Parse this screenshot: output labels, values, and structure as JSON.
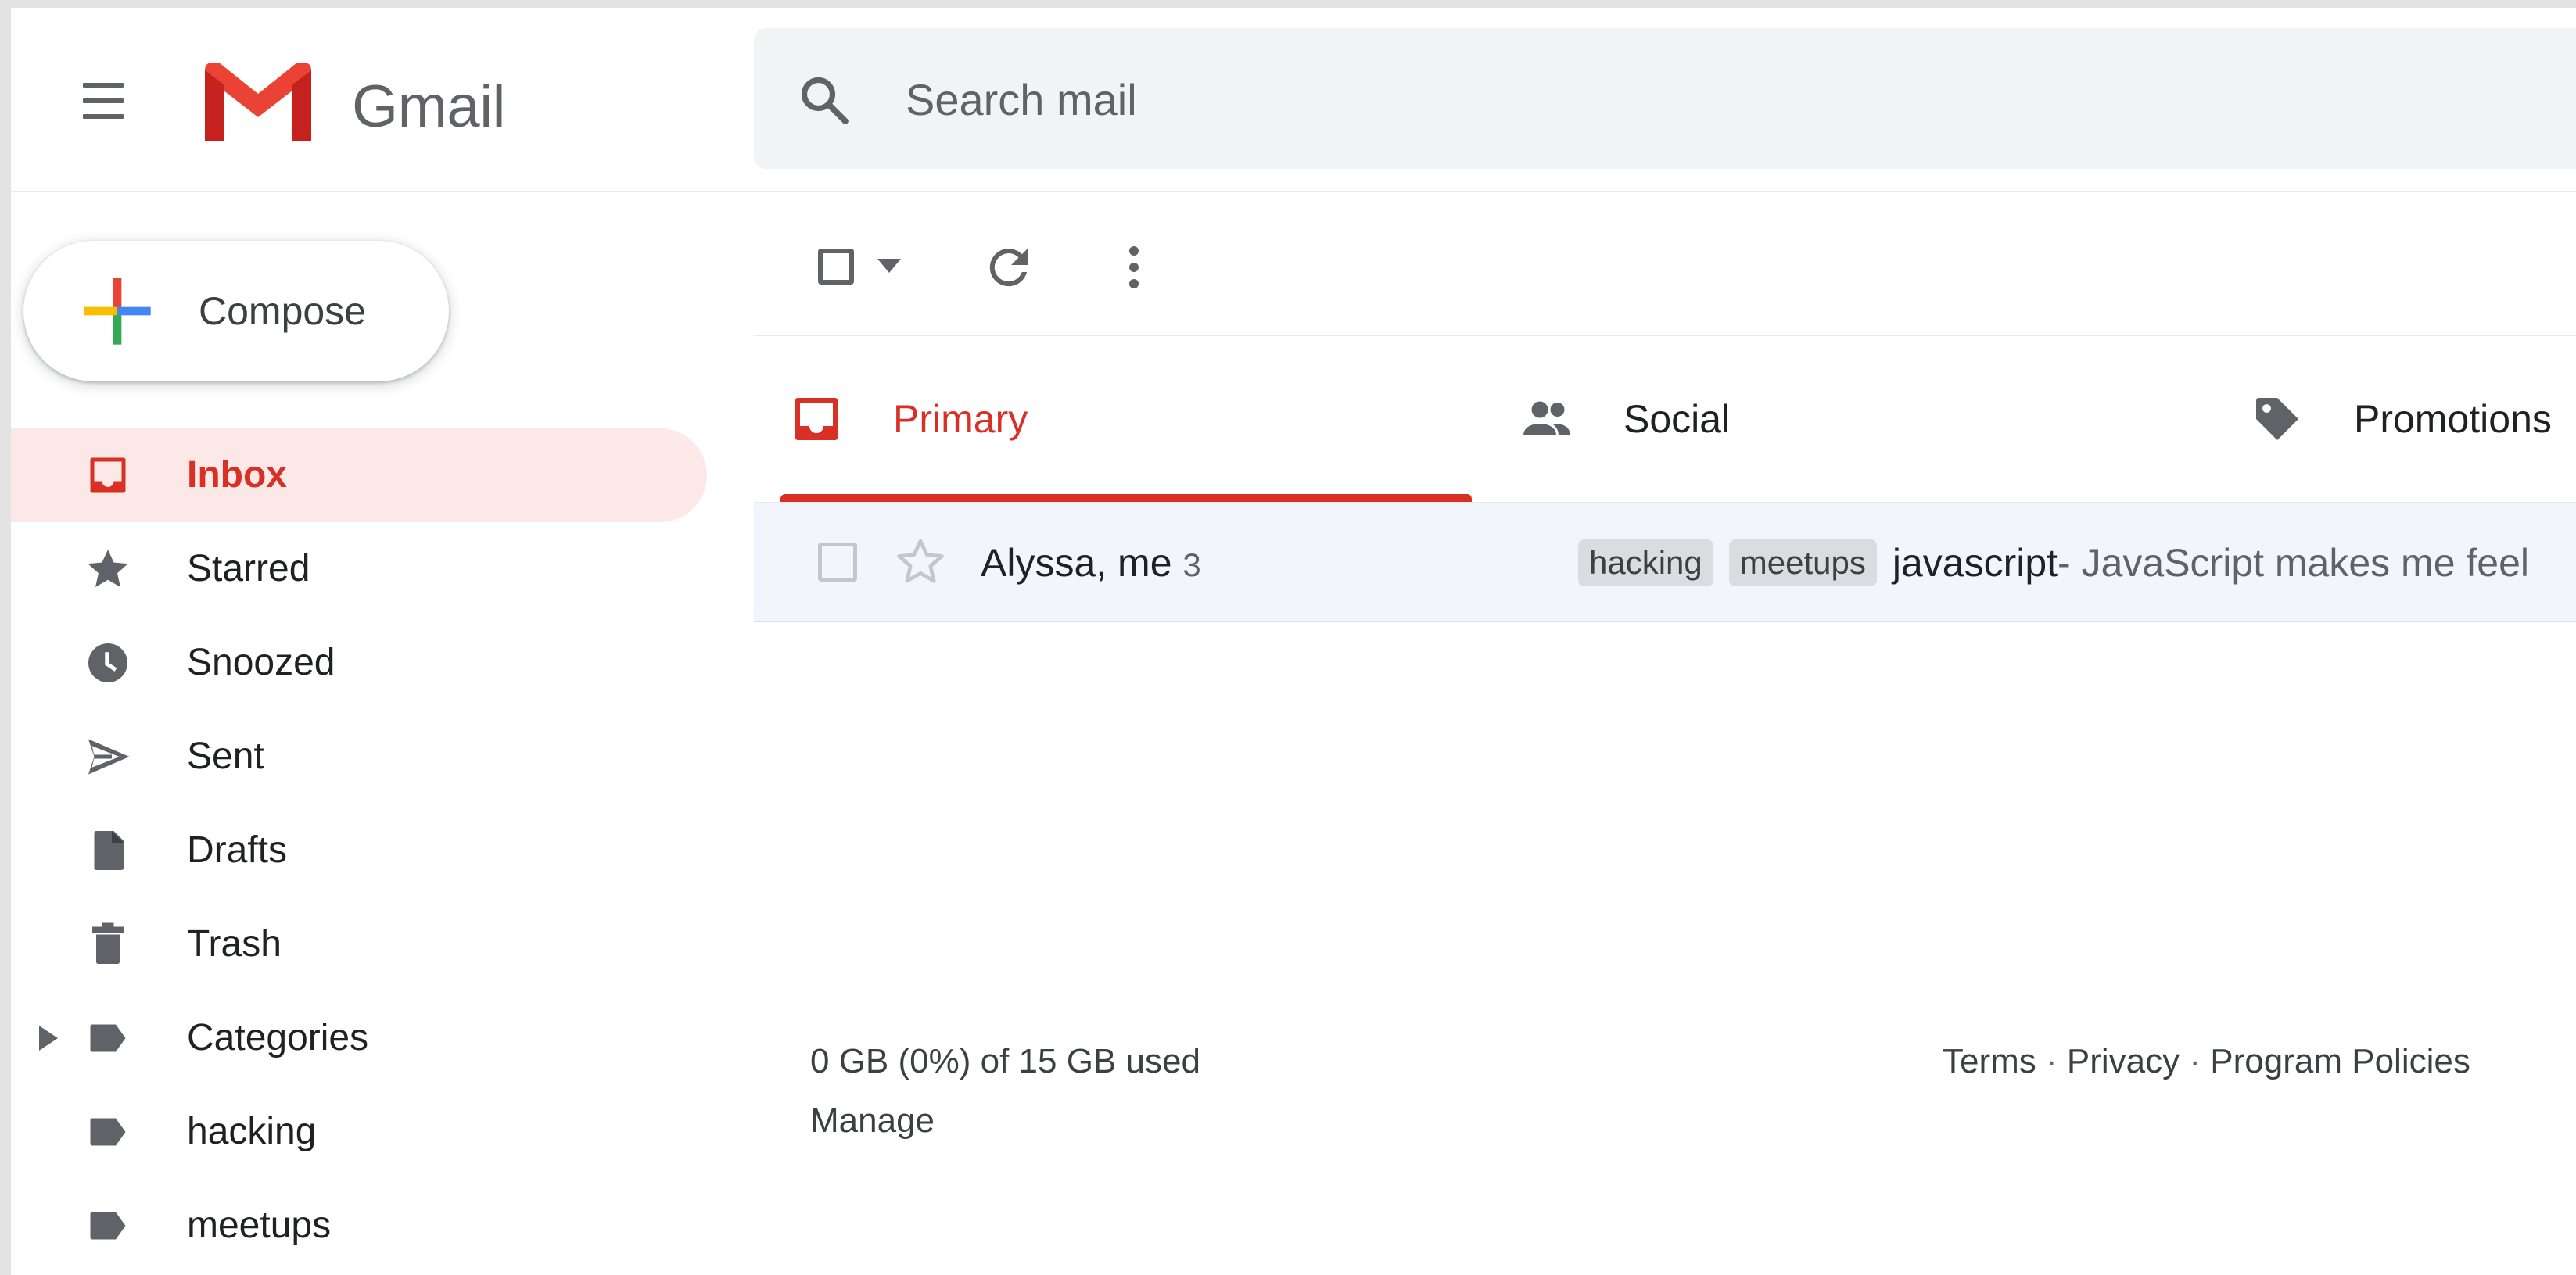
{
  "header": {
    "brand": "Gmail",
    "search": {
      "placeholder": "Search mail",
      "value": ""
    }
  },
  "compose": {
    "label": "Compose"
  },
  "sidebar": {
    "items": [
      {
        "label": "Inbox",
        "icon": "inbox-icon",
        "active": true
      },
      {
        "label": "Starred",
        "icon": "star-icon"
      },
      {
        "label": "Snoozed",
        "icon": "clock-icon"
      },
      {
        "label": "Sent",
        "icon": "send-icon"
      },
      {
        "label": "Drafts",
        "icon": "draft-icon"
      },
      {
        "label": "Trash",
        "icon": "trash-icon"
      },
      {
        "label": "Categories",
        "icon": "label-icon"
      },
      {
        "label": "hacking",
        "icon": "label-icon"
      },
      {
        "label": "meetups",
        "icon": "label-icon"
      }
    ]
  },
  "tabs": [
    {
      "label": "Primary",
      "icon": "inbox-icon",
      "active": true
    },
    {
      "label": "Social",
      "icon": "people-icon"
    },
    {
      "label": "Promotions",
      "icon": "tag-icon"
    }
  ],
  "messages": [
    {
      "sender": "Alyssa, me",
      "count": "3",
      "labels": [
        "hacking",
        "meetups"
      ],
      "subject": "javascript",
      "snippet": " - JavaScript makes me feel"
    }
  ],
  "footer": {
    "storage": "0 GB (0%) of 15 GB used",
    "manage": "Manage",
    "terms": "Terms",
    "privacy": "Privacy",
    "program_policies": "Program Policies",
    "separator": "·"
  },
  "colors": {
    "accent": "#d93025",
    "active_bg": "#fce8e6",
    "row_bg": "#f2f6fc",
    "search_bg": "#f1f3f4"
  }
}
